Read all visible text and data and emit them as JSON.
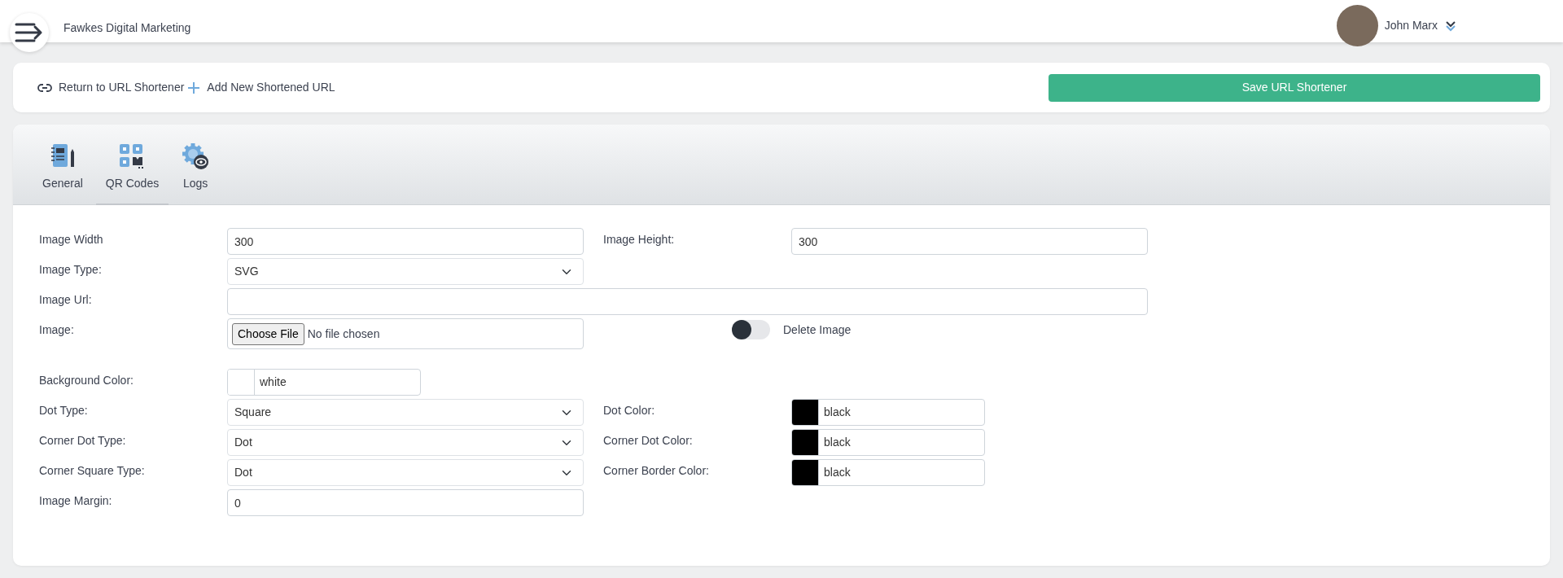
{
  "header": {
    "title": "Fawkes Digital Marketing",
    "user": "John Marx"
  },
  "actions": {
    "links": [
      {
        "kind": "link",
        "label": "Return to URL Shortener"
      },
      {
        "kind": "plus",
        "label": "Add New Shortened URL"
      }
    ],
    "save": "Save URL Shortener"
  },
  "tabs": [
    {
      "kind": "notebook",
      "label": "General",
      "selected": false
    },
    {
      "kind": "qr",
      "label": "QR Codes",
      "selected": true
    },
    {
      "kind": "gear",
      "label": "Logs",
      "selected": false
    }
  ],
  "rows": [
    {
      "left": {
        "kind": "text",
        "label": "Image Width",
        "value": "300"
      },
      "right": {
        "kind": "text",
        "label": "Image Height:",
        "value": "300"
      }
    },
    {
      "left": {
        "kind": "select",
        "label": "Image Type:",
        "value": "SVG"
      }
    },
    {
      "left": {
        "kind": "wide",
        "label": "Image Url:"
      }
    },
    {
      "left": {
        "kind": "file",
        "label": "Image:",
        "button": "Choose File",
        "value": "No file chosen"
      },
      "right": {
        "kind": "switch",
        "label": "Delete Image",
        "on": false
      }
    },
    {
      "left": {
        "kind": "color",
        "label": "Background Color:",
        "value": "white",
        "color": "#ffffff"
      }
    },
    {
      "left": {
        "kind": "select",
        "label": "Dot Type:",
        "value": "Square"
      },
      "right": {
        "kind": "color",
        "label": "Dot Color:",
        "value": "black",
        "color": "#000000"
      }
    },
    {
      "left": {
        "kind": "select",
        "label": "Corner Dot Type:",
        "value": "Dot"
      },
      "right": {
        "kind": "color",
        "label": "Corner Dot Color:",
        "value": "black",
        "color": "#000000"
      }
    },
    {
      "left": {
        "kind": "select",
        "label": "Corner Square Type:",
        "value": "Dot"
      },
      "right": {
        "kind": "color",
        "label": "Corner Border Color:",
        "value": "black",
        "color": "#000000"
      }
    },
    {
      "left": {
        "kind": "text",
        "label": "Image Margin:",
        "value": "0"
      }
    }
  ]
}
